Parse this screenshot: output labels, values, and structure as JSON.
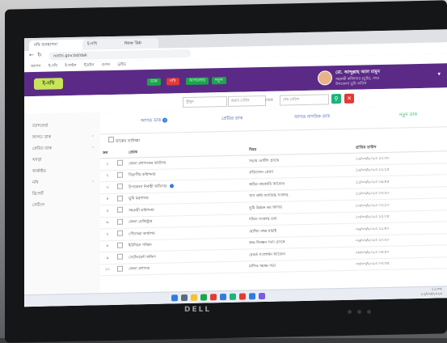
{
  "browser": {
    "tabs": [
      "নথি ব্যবস্থাপনা",
      "ই-নথি",
      "New Tab"
    ],
    "url": "nothi.gov.bd/dak",
    "bookmarks": [
      "অ্যাপস",
      "ই-নথি",
      "ই-ফাইল",
      "ইমেইল",
      "গুগল",
      "ড্রাইভ"
    ]
  },
  "header": {
    "logo": "ই-নথি",
    "buttons": [
      {
        "label": "ডাক",
        "color": "#1aa64b"
      },
      {
        "label": "নথি",
        "color": "#e53935"
      },
      {
        "label": "আপলোড",
        "color": "#1aa64b"
      },
      {
        "label": "নতুন",
        "color": "#1aa64b"
      }
    ],
    "user": {
      "name": "মো. আব্দুল্লাহ আল মামুন",
      "line2": "সহকারী কমিশনার (ভূমি), সদর",
      "line3": "উপজেলা ভূমি অফিস"
    }
  },
  "toolbar": {
    "search_placeholder": "খুঁজুন",
    "date_from": "শুরুর তারিখ",
    "date_to": "শেষ তারিখ",
    "separator": "থেকে"
  },
  "sidebar": {
    "items": [
      "ড্যাশবোর্ড",
      "আগত ডাক",
      "প্রেরিত ডাক",
      "খসড়া",
      "আর্কাইভ",
      "নথি",
      "রিপোর্ট",
      "সেটিংস"
    ]
  },
  "content": {
    "tabs": [
      {
        "label": "আগত ডাক",
        "count": "৫"
      },
      {
        "label": "প্রেরিত ডাক"
      },
      {
        "label": "আগত নাগরিক ডাক"
      },
      {
        "label": "নতুন ডাক"
      }
    ],
    "filter_label": "ডাকের তালিকা",
    "table": {
      "columns": [
        "ক্রম",
        "প্রেরক",
        "বিষয়",
        "প্রাপ্তির তারিখ"
      ],
      "rows": [
        {
          "no": "১",
          "sender": "জেলা প্রশাসকের কার্যালয়",
          "subject": "সভার নোটিশ প্রসঙ্গে",
          "date": "১২/০৩/২০২৩ ১০:৩০"
        },
        {
          "no": "২",
          "sender": "বিভাগীয় কমিশনার",
          "subject": "প্রতিবেদন প্রেরণ",
          "date": "১২/০৩/২০২৩ ১১:১৫"
        },
        {
          "no": "৩",
          "sender": "উপজেলা নির্বাহী অফিসার",
          "subject": "জমির নামজারি আবেদন",
          "date": "১১/০৩/২০২৩ ০৯:৪৫",
          "flag": true
        },
        {
          "no": "৪",
          "sender": "ভূমি মন্ত্রণালয়",
          "subject": "খাস জমি বন্দোবস্ত সংক্রান্ত",
          "date": "১১/০৩/২০২৩ ০৩:২০"
        },
        {
          "no": "৫",
          "sender": "সহকারী কমিশনার",
          "subject": "ভূমি উন্নয়ন কর আদায়",
          "date": "১০/০৩/২০২৩ ০২:১০"
        },
        {
          "no": "৬",
          "sender": "জেলা রেজিস্ট্রার",
          "subject": "দলিল সংক্রান্ত তথ্য",
          "date": "১০/০৩/২০২৩ ১২:০৫"
        },
        {
          "no": "৭",
          "sender": "পৌরসভা কার্যালয়",
          "subject": "হোল্ডিং নম্বর যাচাই",
          "date": "০৯/০৩/২০২৩ ১১:৪০"
        },
        {
          "no": "৮",
          "sender": "ইউনিয়ন পরিষদ",
          "subject": "জন্ম নিবন্ধন সনদ প্রসঙ্গে",
          "date": "০৯/০৩/২০২৩ ১০:২০"
        },
        {
          "no": "৯",
          "sender": "সেটেলমেন্ট অফিস",
          "subject": "রেকর্ড সংশোধন আবেদন",
          "date": "০৮/০৩/২০২৩ ০৪:৫০"
        },
        {
          "no": "১০",
          "sender": "জেলা প্রশাসক",
          "subject": "মাসিক সমন্বয় সভা",
          "date": "০৮/০৩/২০২৩ ০৩:৩৫"
        }
      ]
    }
  },
  "taskbar": {
    "time": "১১:০৫",
    "date": "১২/০৩/২০২৩"
  },
  "monitor": {
    "brand": "DELL"
  },
  "colors": {
    "header": "#5b2a86",
    "accent_green": "#1aa64b",
    "accent_red": "#e53935",
    "link_blue": "#2f5aa8"
  }
}
